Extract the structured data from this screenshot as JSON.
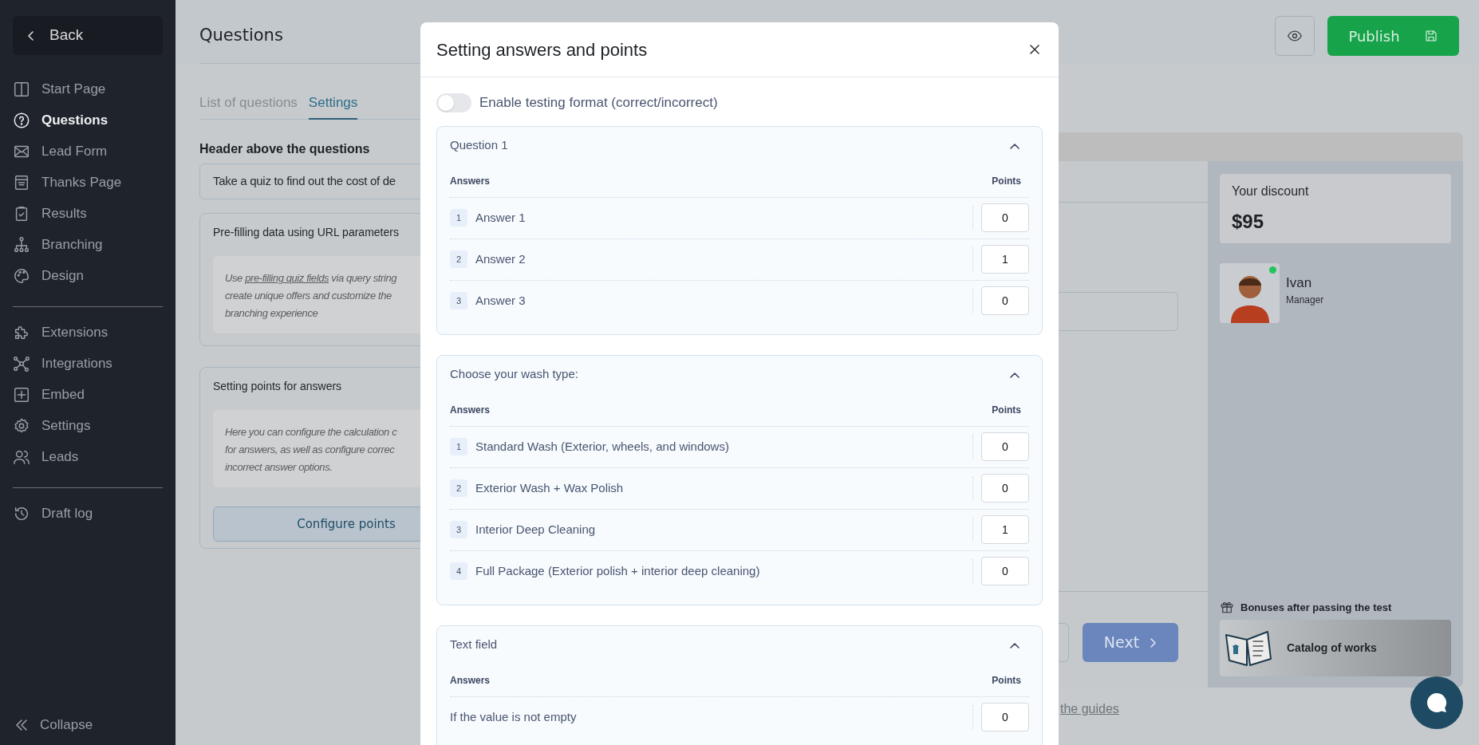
{
  "sidebar": {
    "back": "Back",
    "groups": [
      {
        "items": [
          {
            "label": "Start Page",
            "selected": false
          },
          {
            "label": "Questions",
            "selected": true
          },
          {
            "label": "Lead Form",
            "selected": false
          },
          {
            "label": "Thanks Page",
            "selected": false
          },
          {
            "label": "Results",
            "selected": false
          },
          {
            "label": "Branching",
            "selected": false
          },
          {
            "label": "Design",
            "selected": false
          }
        ]
      },
      {
        "items": [
          {
            "label": "Extensions",
            "selected": false
          },
          {
            "label": "Integrations",
            "selected": false
          },
          {
            "label": "Embed",
            "selected": false
          },
          {
            "label": "Settings",
            "selected": false
          },
          {
            "label": "Leads",
            "selected": false
          }
        ]
      },
      {
        "items": [
          {
            "label": "Draft log",
            "selected": false
          }
        ]
      }
    ],
    "collapse": "Collapse"
  },
  "header": {
    "title": "Questions",
    "publish": "Publish"
  },
  "tabs": [
    {
      "label": "List of questions",
      "selected": false
    },
    {
      "label": "Settings",
      "selected": true
    }
  ],
  "settings": {
    "header_label": "Header above the questions",
    "header_value": "Take a quiz to find out the cost of de",
    "prefill": {
      "title": "Pre-filling data using URL parameters",
      "first_line": {
        "before": "Use",
        "link": "pre-filling quiz fields",
        "after": "via query string"
      },
      "lines": [
        "create unique offers and customize the",
        "branching experience"
      ]
    },
    "points": {
      "title": "Setting points for answers",
      "lines": [
        "Here you can configure the calculation c",
        "for answers, as well as configure correc",
        "incorrect answer options."
      ],
      "button": "Configure points"
    }
  },
  "modal": {
    "title": "Setting answers and points",
    "toggle": {
      "label": "Enable testing format (correct/incorrect)",
      "on": false
    },
    "sections": [
      {
        "title": "Question 1",
        "expanded": true,
        "answers_heading": "Answers",
        "points_heading": "Points",
        "answers": [
          {
            "number": "1",
            "text": "Answer 1",
            "points": "0"
          },
          {
            "number": "2",
            "text": "Answer 2",
            "points": "1"
          },
          {
            "number": "3",
            "text": "Answer 3",
            "points": "0"
          }
        ]
      },
      {
        "title": "Choose your wash type:",
        "expanded": true,
        "answers_heading": "Answers",
        "points_heading": "Points",
        "answers": [
          {
            "number": "1",
            "text": "Standard Wash (Exterior, wheels, and windows)",
            "points": "0"
          },
          {
            "number": "2",
            "text": "Exterior Wash + Wax Polish",
            "points": "0"
          },
          {
            "number": "3",
            "text": "Interior Deep Cleaning",
            "points": "1"
          },
          {
            "number": "4",
            "text": "Full Package (Exterior polish + interior deep cleaning)",
            "points": "0"
          }
        ]
      },
      {
        "title": "Text field",
        "expanded": true,
        "answers_heading": "Answers",
        "points_heading": "Points",
        "answers": [
          {
            "text": "If the value is not empty",
            "points": "0"
          }
        ]
      }
    ]
  },
  "preview": {
    "next": "Next",
    "discount_label": "Your discount",
    "discount_value": "$95",
    "manager": {
      "name": "Ivan",
      "role": "Manager",
      "online": true
    },
    "bonuses_title": "Bonuses after passing the test",
    "bonus": "Catalog of works",
    "guides_link": "the guides"
  }
}
